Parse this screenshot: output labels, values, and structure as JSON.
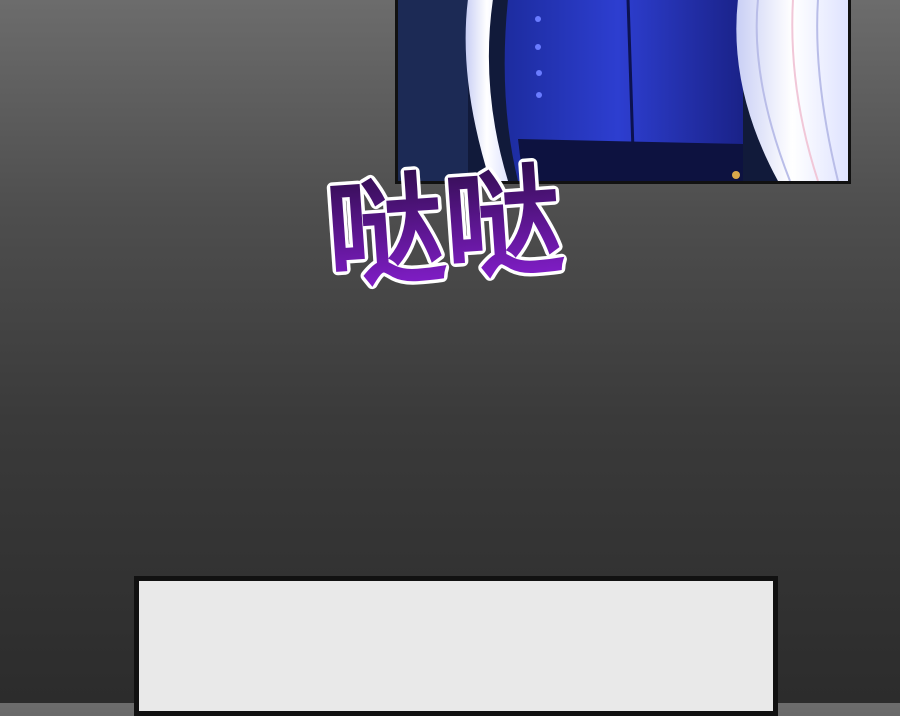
{
  "sound_effect": {
    "text": "哒哒",
    "fill_top": "#2e0d4a",
    "fill_bottom": "#8a1fd6",
    "outline": "#ffffff"
  },
  "palette": {
    "background_top": "#6c6c6c",
    "background_bottom": "#2c2c2c",
    "coat_blue": "#2633b8",
    "hair_white": "#eef0ff",
    "panel_border": "#111111",
    "blank_panel": "#e9e9e9"
  }
}
